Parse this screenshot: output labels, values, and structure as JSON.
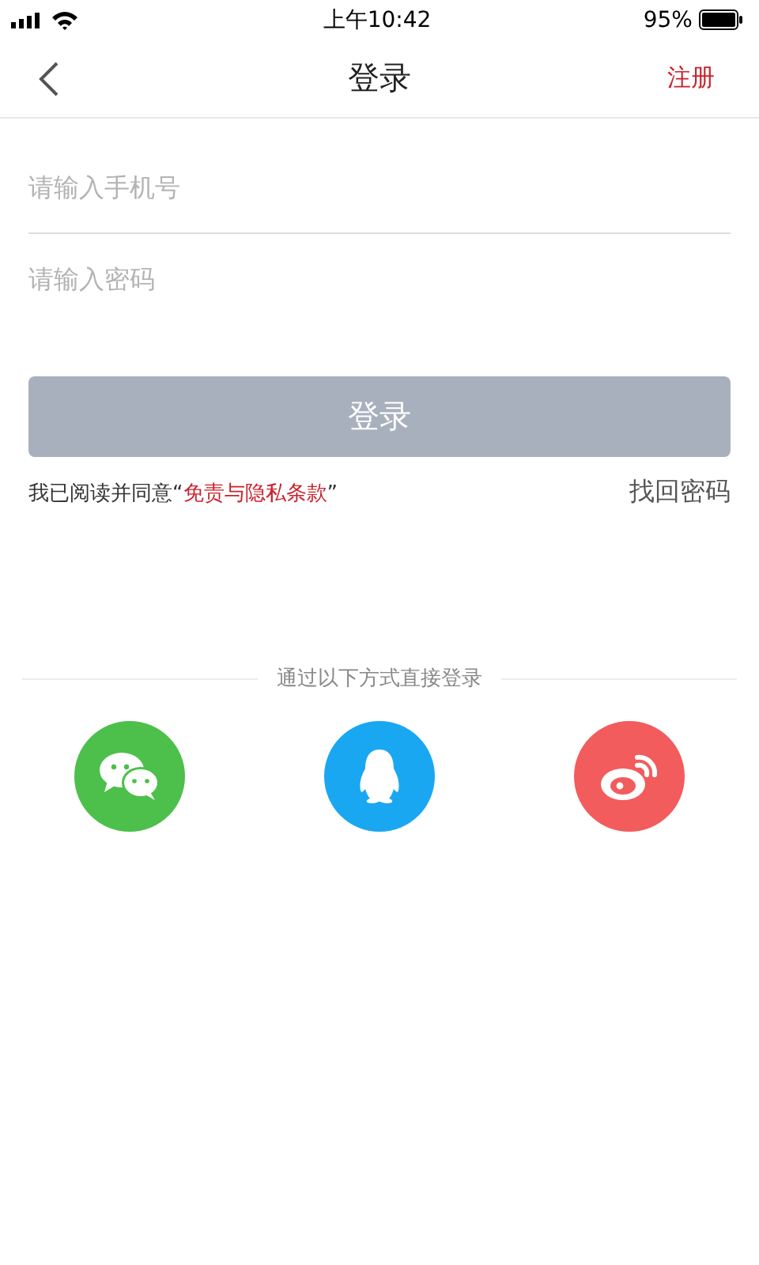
{
  "status_bar": {
    "time": "上午10:42",
    "battery": "95%"
  },
  "nav": {
    "title": "登录",
    "action": "注册"
  },
  "fields": [
    {
      "placeholder": "请输入手机号",
      "underline": true
    },
    {
      "placeholder": "请输入密码",
      "underline": false
    }
  ],
  "login_button": {
    "label": "登录",
    "disabled": true
  },
  "agreement": {
    "prefix": "我已阅读并同意“",
    "link": "免责与隐私条款",
    "suffix": "”"
  },
  "forgot_password": "找回密码",
  "divider_text": "通过以下方式直接登录",
  "social": [
    {
      "kind": "chat",
      "color": "#4cc04a"
    },
    {
      "kind": "penguin",
      "color": "#1aa7f2"
    },
    {
      "kind": "weibo",
      "color": "#f25c5c"
    }
  ]
}
